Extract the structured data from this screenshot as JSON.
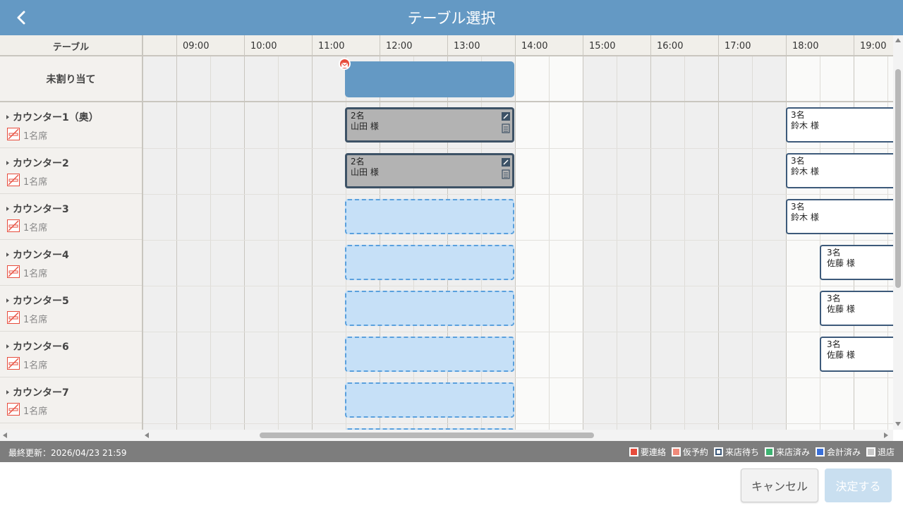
{
  "header": {
    "title": "テーブル選択",
    "back_icon": "chevron-left-icon"
  },
  "grid": {
    "table_column_header": "テーブル",
    "times": [
      "09:00",
      "10:00",
      "11:00",
      "12:00",
      "13:00",
      "14:00",
      "15:00",
      "16:00",
      "17:00",
      "18:00",
      "19:00"
    ],
    "unassigned_label": "未割り当て",
    "tables": [
      {
        "name": "カウンター1（奥）",
        "seats": "1名席"
      },
      {
        "name": "カウンター2",
        "seats": "1名席"
      },
      {
        "name": "カウンター3",
        "seats": "1名席"
      },
      {
        "name": "カウンター4",
        "seats": "1名席"
      },
      {
        "name": "カウンター5",
        "seats": "1名席"
      },
      {
        "name": "カウンター6",
        "seats": "1名席"
      },
      {
        "name": "カウンター7",
        "seats": "1名席"
      }
    ],
    "reservations": [
      {
        "party": "2名",
        "name": "山田 様"
      },
      {
        "party": "2名",
        "name": "山田 様"
      },
      {
        "party": "3名",
        "name": "鈴木 様"
      },
      {
        "party": "3名",
        "name": "鈴木 様"
      },
      {
        "party": "3名",
        "name": "鈴木 様"
      },
      {
        "party": "3名",
        "name": "佐藤 様"
      },
      {
        "party": "3名",
        "name": "佐藤 様"
      },
      {
        "party": "3名",
        "name": "佐藤 様"
      }
    ]
  },
  "status": {
    "last_update": "最終更新：2026/04/23 21:59",
    "legend": [
      {
        "label": "要連絡",
        "color": "#e74c3c"
      },
      {
        "label": "仮予約",
        "color": "#f08a7a"
      },
      {
        "label": "来店待ち",
        "color": "#ffffff"
      },
      {
        "label": "来店済み",
        "color": "#3cb371"
      },
      {
        "label": "会計済み",
        "color": "#3a6fd8"
      },
      {
        "label": "退店",
        "color": "#c8c8c8"
      }
    ]
  },
  "footer": {
    "cancel_label": "キャンセル",
    "confirm_label": "決定する"
  }
}
